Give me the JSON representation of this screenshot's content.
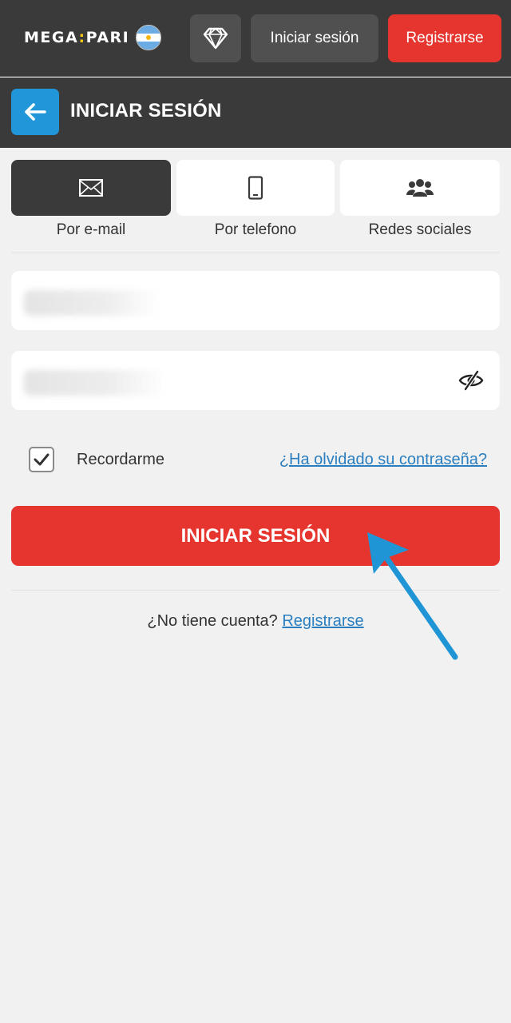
{
  "brand": {
    "logo_left": "MEGA",
    "logo_sep": ":",
    "logo_right": "PARI"
  },
  "topbar": {
    "login_label": "Iniciar sesión",
    "register_label": "Registrarse"
  },
  "header": {
    "title": "INICIAR SESIÓN"
  },
  "tabs": [
    {
      "label": "Por e-mail",
      "icon": "envelope-icon",
      "active": true
    },
    {
      "label": "Por telefono",
      "icon": "phone-icon",
      "active": false
    },
    {
      "label": "Redes sociales",
      "icon": "users-icon",
      "active": false
    }
  ],
  "form": {
    "remember_label": "Recordarme",
    "remember_checked": true,
    "forgot_label": "¿Ha olvidado su contraseña?",
    "submit_label": "INICIAR SESIÓN"
  },
  "footer": {
    "no_account_text": "¿No tiene cuenta?",
    "register_link": "Registrarse"
  },
  "colors": {
    "bar_bg": "#3a3a3a",
    "accent_red": "#e5352e",
    "accent_blue": "#2196d8",
    "link_blue": "#2b7fc0",
    "page_bg": "#f1f1f1"
  }
}
